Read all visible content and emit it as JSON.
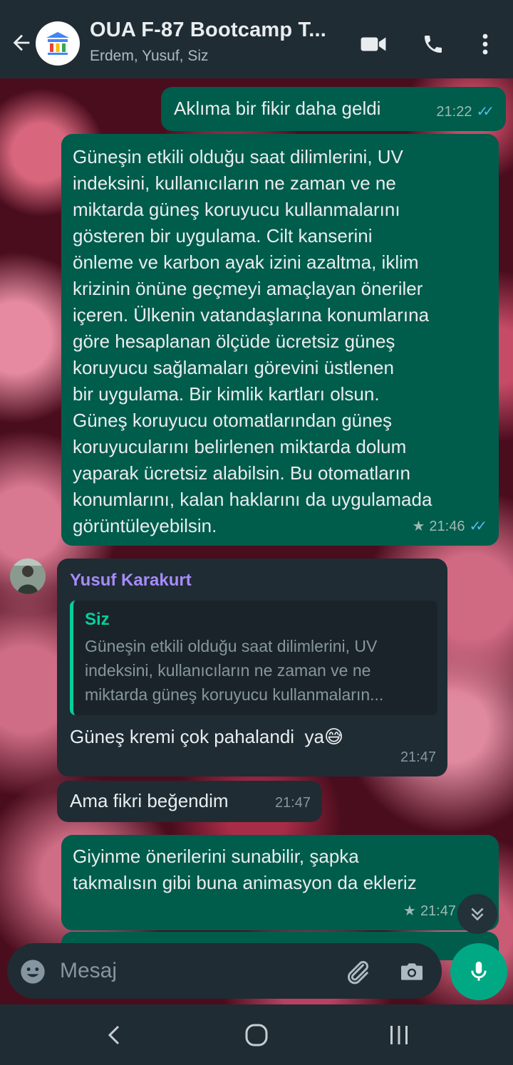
{
  "header": {
    "title": "OUA F-87 Bootcamp T...",
    "subtitle": "Erdem, Yusuf, Siz"
  },
  "messages": {
    "m1": {
      "text": "Aklıma bir fikir daha geldi",
      "time": "21:22",
      "ticks": "✓✓"
    },
    "m2": {
      "lines": [
        "Güneşin etkili olduğu saat dilimlerini, UV",
        "indeksini, kullanıcıların ne zaman ve ne",
        "miktarda güneş koruyucu kullanmalarını",
        "gösteren bir uygulama. Cilt kanserini",
        "önleme ve karbon ayak izini azaltma, iklim",
        "krizinin önüne geçmeyi amaçlayan öneriler",
        "içeren. Ülkenin vatandaşlarına konumlarına",
        "göre hesaplanan ölçüde ücretsiz güneş",
        "koruyucu sağlamaları görevini üstlenen",
        "bir uygulama. Bir kimlik kartları olsun.",
        "Güneş koruyucu otomatlarından güneş",
        "koruyucularını belirlenen miktarda dolum",
        "yaparak ücretsiz alabilsin. Bu otomatların",
        "konumlarını, kalan haklarını da uygulamada",
        "görüntüleyebilsin."
      ],
      "time": "21:46",
      "star": "★",
      "ticks": "✓✓"
    },
    "m3": {
      "sender": "Yusuf Karakurt",
      "quote_name": "Siz",
      "quote_lines": [
        "Güneşin etkili olduğu saat dilimlerini, UV",
        "indeksini, kullanıcıların ne zaman ve ne",
        "miktarda güneş koruyucu kullanmaların..."
      ],
      "text": "Güneş kremi çok pahalandi  ya",
      "emoji": "😅",
      "time": "21:47"
    },
    "m4": {
      "text": "Ama fikri beğendim",
      "time": "21:47"
    },
    "m5": {
      "lines": [
        "Giyinme önerilerini sunabilir, şapka",
        "takmalısın gibi buna animasyon da ekleriz"
      ],
      "time": "21:47",
      "star": "★"
    }
  },
  "composer": {
    "placeholder": "Mesaj"
  },
  "icons": {
    "back": "back-arrow-icon",
    "group_avatar": "google-logo-icon",
    "video": "video-call-icon",
    "call": "phone-icon",
    "menu": "more-vert-icon",
    "emoji": "emoji-icon",
    "attach": "paperclip-icon",
    "camera": "camera-icon",
    "mic": "microphone-icon",
    "scroll_down": "double-chevron-down-icon"
  },
  "colors": {
    "header_bg": "#1f2c34",
    "outgoing_bubble": "#005c4b",
    "incoming_bubble": "#1f2c34",
    "accent_green": "#00a884",
    "read_ticks": "#53bdeb",
    "sender_name": "#a78bfa"
  }
}
